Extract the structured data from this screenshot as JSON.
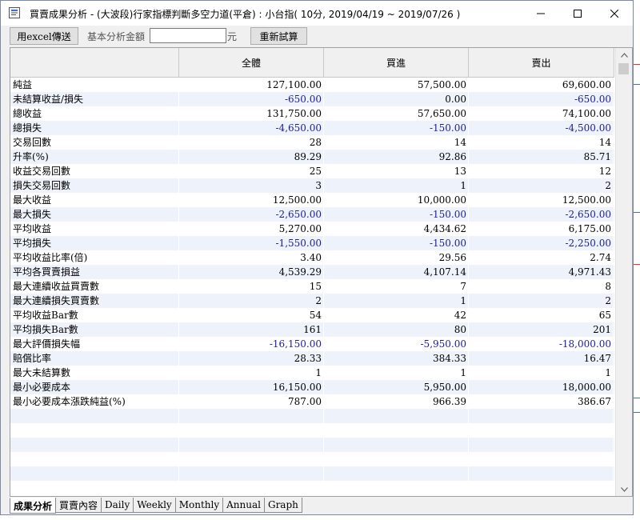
{
  "window": {
    "title": "買賣成果分析 - (大波段)行家指標判斷多空力道(平倉) : 小台指( 10分, 2019/04/19 ~ 2019/07/26 )"
  },
  "toolbar": {
    "export_label": "用excel傳送",
    "amount_label": "基本分析金額",
    "amount_value": "",
    "unit_label": "元",
    "recalc_label": "重新試算"
  },
  "table": {
    "columns": [
      "",
      "全體",
      "買進",
      "賣出"
    ],
    "rows": [
      {
        "label": "純益",
        "values": [
          "127,100.00",
          "57,500.00",
          "69,600.00"
        ],
        "neg": [
          false,
          false,
          false
        ]
      },
      {
        "label": "未結算收益/損失",
        "values": [
          "-650.00",
          "0.00",
          "-650.00"
        ],
        "neg": [
          true,
          false,
          true
        ]
      },
      {
        "label": "總收益",
        "values": [
          "131,750.00",
          "57,650.00",
          "74,100.00"
        ],
        "neg": [
          false,
          false,
          false
        ]
      },
      {
        "label": "總損失",
        "values": [
          "-4,650.00",
          "-150.00",
          "-4,500.00"
        ],
        "neg": [
          true,
          true,
          true
        ]
      },
      {
        "label": "交易回數",
        "values": [
          "28",
          "14",
          "14"
        ],
        "neg": [
          false,
          false,
          false
        ]
      },
      {
        "label": "升率(%)",
        "values": [
          "89.29",
          "92.86",
          "85.71"
        ],
        "neg": [
          false,
          false,
          false
        ]
      },
      {
        "label": "收益交易回數",
        "values": [
          "25",
          "13",
          "12"
        ],
        "neg": [
          false,
          false,
          false
        ]
      },
      {
        "label": "損失交易回數",
        "values": [
          "3",
          "1",
          "2"
        ],
        "neg": [
          false,
          false,
          false
        ]
      },
      {
        "label": "最大收益",
        "values": [
          "12,500.00",
          "10,000.00",
          "12,500.00"
        ],
        "neg": [
          false,
          false,
          false
        ]
      },
      {
        "label": "最大損失",
        "values": [
          "-2,650.00",
          "-150.00",
          "-2,650.00"
        ],
        "neg": [
          true,
          true,
          true
        ]
      },
      {
        "label": "平均收益",
        "values": [
          "5,270.00",
          "4,434.62",
          "6,175.00"
        ],
        "neg": [
          false,
          false,
          false
        ]
      },
      {
        "label": "平均損失",
        "values": [
          "-1,550.00",
          "-150.00",
          "-2,250.00"
        ],
        "neg": [
          true,
          true,
          true
        ]
      },
      {
        "label": "平均收益比率(倍)",
        "values": [
          "3.40",
          "29.56",
          "2.74"
        ],
        "neg": [
          false,
          false,
          false
        ]
      },
      {
        "label": "平均各買賣損益",
        "values": [
          "4,539.29",
          "4,107.14",
          "4,971.43"
        ],
        "neg": [
          false,
          false,
          false
        ]
      },
      {
        "label": "最大連續收益買賣數",
        "values": [
          "15",
          "7",
          "8"
        ],
        "neg": [
          false,
          false,
          false
        ]
      },
      {
        "label": "最大連續損失買賣數",
        "values": [
          "2",
          "1",
          "2"
        ],
        "neg": [
          false,
          false,
          false
        ]
      },
      {
        "label": "平均收益Bar數",
        "values": [
          "54",
          "42",
          "65"
        ],
        "neg": [
          false,
          false,
          false
        ]
      },
      {
        "label": "平均損失Bar數",
        "values": [
          "161",
          "80",
          "201"
        ],
        "neg": [
          false,
          false,
          false
        ]
      },
      {
        "label": "最大評價損失幅",
        "values": [
          "-16,150.00",
          "-5,950.00",
          "-18,000.00"
        ],
        "neg": [
          true,
          true,
          true
        ]
      },
      {
        "label": "賠償比率",
        "values": [
          "28.33",
          "384.33",
          "16.47"
        ],
        "neg": [
          false,
          false,
          false
        ]
      },
      {
        "label": "最大未結算數",
        "values": [
          "1",
          "1",
          "1"
        ],
        "neg": [
          false,
          false,
          false
        ]
      },
      {
        "label": "最小必要成本",
        "values": [
          "16,150.00",
          "5,950.00",
          "18,000.00"
        ],
        "neg": [
          false,
          false,
          false
        ]
      },
      {
        "label": "最小必要成本漲跌純益(%)",
        "values": [
          "787.00",
          "966.39",
          "386.67"
        ],
        "neg": [
          false,
          false,
          false
        ]
      }
    ]
  },
  "tabs": [
    "成果分析",
    "買賣內容",
    "Daily",
    "Weekly",
    "Monthly",
    "Annual",
    "Graph"
  ],
  "active_tab": "成果分析",
  "colors": {
    "negative": "#1a1aa6",
    "alt_row": "#eef3fb",
    "header_bg": "#f0f0f0"
  }
}
